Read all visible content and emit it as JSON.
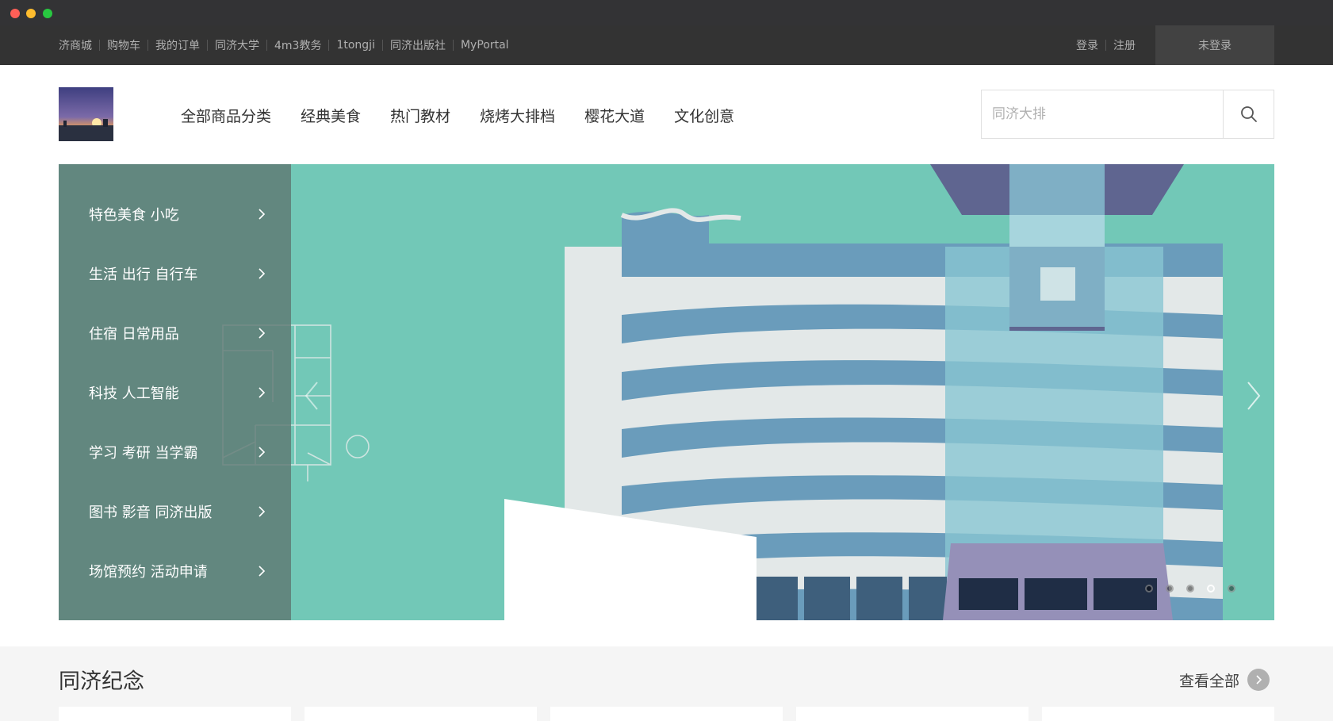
{
  "topbar": {
    "links": [
      "济商城",
      "购物车",
      "我的订单",
      "同济大学",
      "4m3教务",
      "1tongji",
      "同济出版社",
      "MyPortal"
    ],
    "login": "登录",
    "register": "注册",
    "status": "未登录"
  },
  "header": {
    "logo_icon": "campus-sunset-logo",
    "nav": [
      "全部商品分类",
      "经典美食",
      "热门教材",
      "烧烤大排档",
      "樱花大道",
      "文化创意"
    ],
    "search_placeholder": "同济大排",
    "search_icon": "search-icon"
  },
  "hero": {
    "categories": [
      "特色美食 小吃",
      "生活 出行 自行车",
      "住宿 日常用品",
      "科技 人工智能",
      "学习 考研 当学霸",
      "图书 影音 同济出版",
      "场馆预约 活动申请"
    ],
    "slide_count": 5,
    "active_slide": 4,
    "colors": {
      "background": "#72c8b7",
      "menu": "#5f7973",
      "building_stripe": "#6a9cbb",
      "building_body": "#e3e8e8"
    }
  },
  "section": {
    "title": "同济纪念",
    "view_all": "查看全部"
  }
}
